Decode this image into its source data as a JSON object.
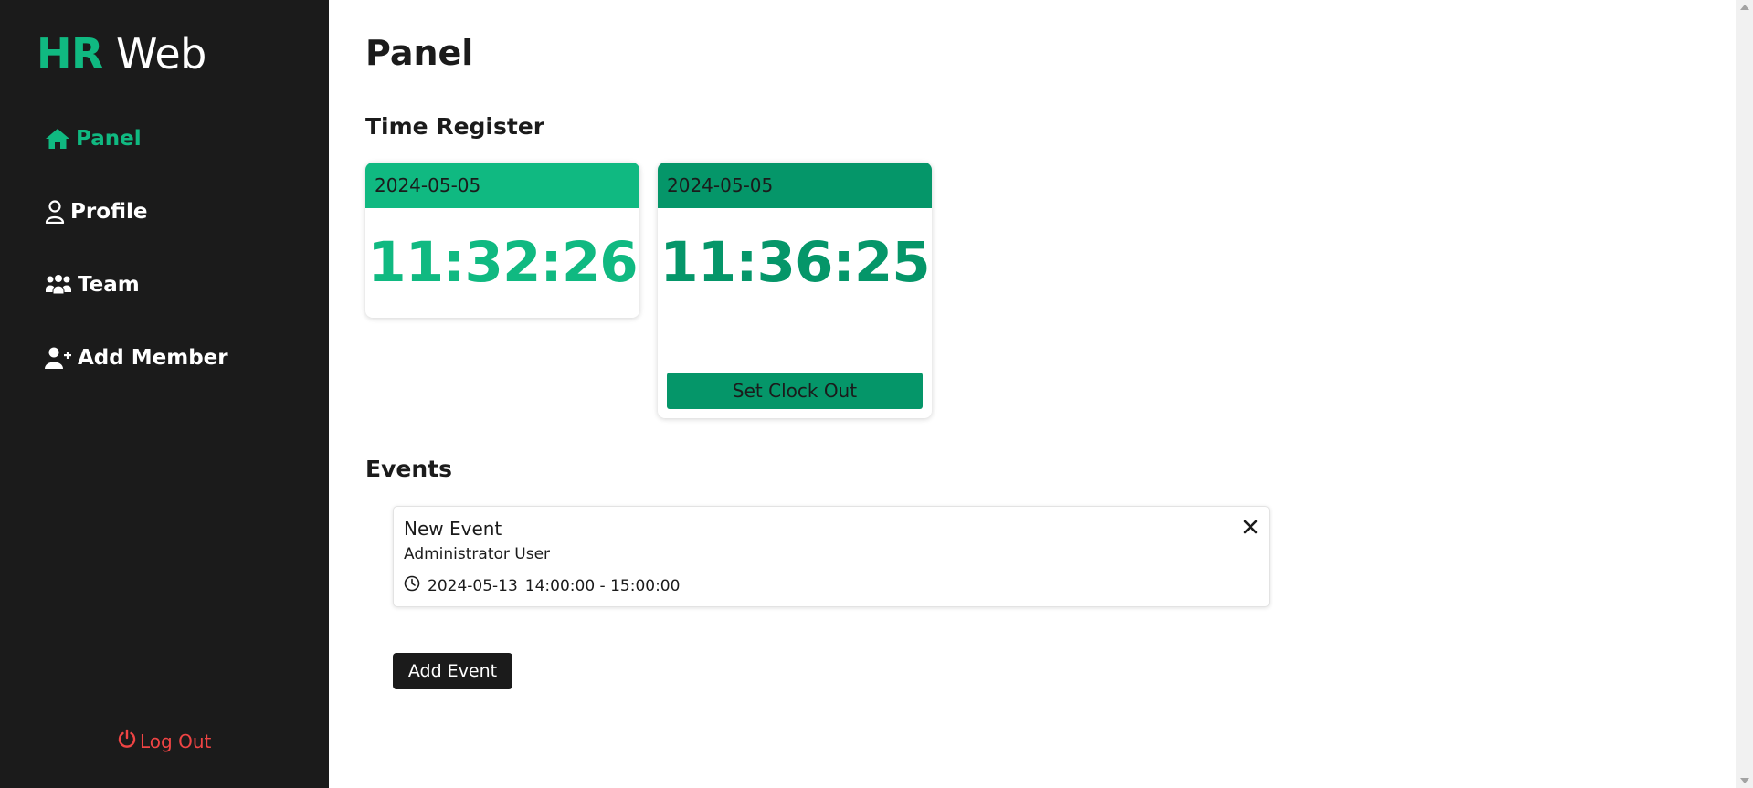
{
  "app": {
    "brand_accent": "HR",
    "brand_rest": "Web"
  },
  "colors": {
    "accent": "#10b981",
    "accent_dark": "#059669",
    "sidebar_bg": "#1b1b1b",
    "logout": "#ef4444"
  },
  "sidebar": {
    "items": [
      {
        "label": "Panel",
        "icon": "home-icon",
        "active": true
      },
      {
        "label": "Profile",
        "icon": "user-icon"
      },
      {
        "label": "Team",
        "icon": "team-icon"
      },
      {
        "label": "Add Member",
        "icon": "user-plus-icon"
      }
    ],
    "logout_label": "Log Out"
  },
  "main": {
    "title": "Panel",
    "time_register": {
      "heading": "Time Register",
      "clock_in": {
        "date": "2024-05-05",
        "time": "11:32:26"
      },
      "clock_out": {
        "date": "2024-05-05",
        "time": "11:36:25",
        "button_label": "Set Clock Out"
      }
    },
    "events": {
      "heading": "Events",
      "items": [
        {
          "title": "New Event",
          "author": "Administrator User",
          "date": "2024-05-13",
          "time_range": "14:00:00 - 15:00:00"
        }
      ],
      "add_label": "Add Event"
    }
  }
}
